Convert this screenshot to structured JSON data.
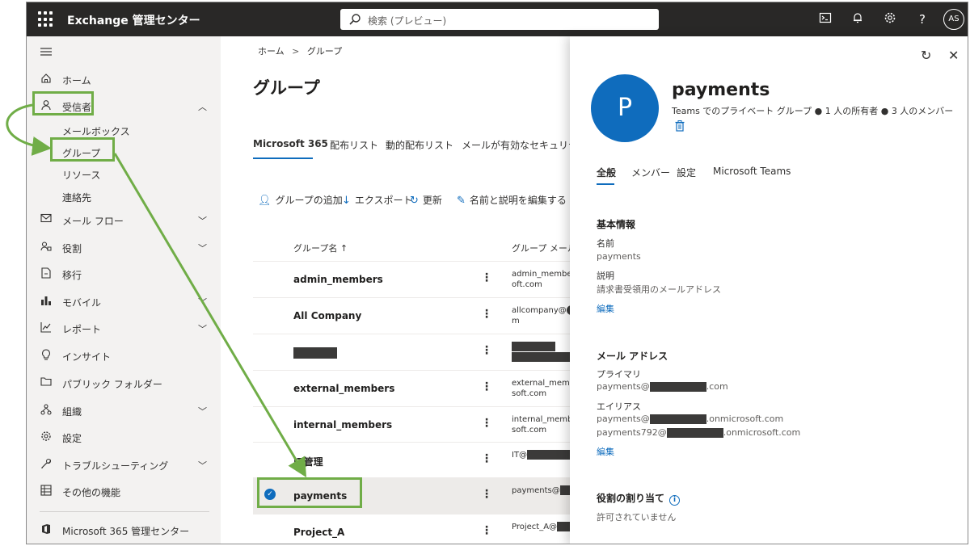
{
  "header": {
    "app_title": "Exchange 管理センター",
    "search_placeholder": "検索 (プレビュー)",
    "help": "?",
    "avatar_initials": "AS"
  },
  "nav": {
    "items": [
      {
        "label": "ホーム",
        "icon": "home-icon"
      },
      {
        "label": "受信者",
        "icon": "person-icon"
      },
      {
        "label": "メールボックス"
      },
      {
        "label": "グループ"
      },
      {
        "label": "リソース"
      },
      {
        "label": "連絡先"
      },
      {
        "label": "メール フロー",
        "icon": "mail-icon"
      },
      {
        "label": "役割",
        "icon": "roles-icon"
      },
      {
        "label": "移行",
        "icon": "migration-icon"
      },
      {
        "label": "モバイル",
        "icon": "mobile-icon"
      },
      {
        "label": "レポート",
        "icon": "report-icon"
      },
      {
        "label": "インサイト",
        "icon": "insight-icon"
      },
      {
        "label": "パブリック フォルダー",
        "icon": "folder-icon"
      },
      {
        "label": "組織",
        "icon": "org-icon"
      },
      {
        "label": "設定",
        "icon": "settings-icon"
      },
      {
        "label": "トラブルシューティング",
        "icon": "wrench-icon"
      },
      {
        "label": "その他の機能",
        "icon": "grid-icon"
      },
      {
        "label": "Microsoft 365 管理センター",
        "icon": "office-icon"
      }
    ]
  },
  "main": {
    "breadcrumb_home": "ホーム",
    "breadcrumb_sep": ">",
    "breadcrumb_current": "グループ",
    "title": "グループ",
    "tabs": [
      "Microsoft 365",
      "配布リスト",
      "動的配布リスト",
      "メールが有効なセキュリティ"
    ],
    "commands": [
      "グループの追加",
      "エクスポート",
      "更新",
      "名前と説明を編集する"
    ],
    "col_name": "グループ名 ↑",
    "col_mail": "グループ メール",
    "rows": [
      {
        "name": "admin_members",
        "mail1": "admin_members",
        "mail2": "oft.com"
      },
      {
        "name": "All Company",
        "mail1": "allcompany@",
        "mail2": "m"
      },
      {
        "name": "",
        "mail1": "",
        "mail2": ""
      },
      {
        "name": "external_members",
        "mail1": "external_membe",
        "mail2": "soft.com"
      },
      {
        "name": "internal_members",
        "mail1": "internal_membe",
        "mail2": "soft.com"
      },
      {
        "name": "IT管理",
        "mail1": "IT@",
        "mail2": ""
      },
      {
        "name": "payments",
        "mail1": "payments@",
        "mail2": ""
      },
      {
        "name": "Project_A",
        "mail1": "Project_A@",
        "mail2": ""
      }
    ]
  },
  "panel": {
    "avatar_letter": "P",
    "name": "payments",
    "subtitle": "Teams でのプライベート グループ  ● 1 人の所有者  ● 3 人のメンバー",
    "tabs": [
      "全般",
      "メンバー",
      "設定",
      "Microsoft Teams"
    ],
    "basic_info": "基本情報",
    "name_label": "名前",
    "name_value": "payments",
    "desc_label": "説明",
    "desc_value": "請求書受領用のメールアドレス",
    "edit1": "編集",
    "mail_section": "メール アドレス",
    "primary_label": "プライマリ",
    "primary_pre": "payments@",
    "primary_post": ".com",
    "alias_label": "エイリアス",
    "alias1_pre": "payments@",
    "alias1_post": ".onmicrosoft.com",
    "alias2_pre": "payments792@",
    "alias2_post": ".onmicrosoft.com",
    "edit2": "編集",
    "role_section": "役割の割り当て",
    "role_value": "許可されていません"
  },
  "colors": {
    "accent": "#0f6cbd",
    "annotation": "#70ad47",
    "topbar": "#292827"
  }
}
